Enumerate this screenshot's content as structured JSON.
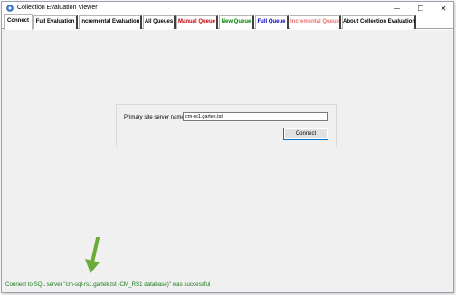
{
  "window": {
    "title": "Collection Evaluation Viewer",
    "controls": {
      "minimize": "─",
      "maximize": "☐",
      "close": "✕"
    }
  },
  "tabs": [
    {
      "label": "Connect",
      "color": "#000000",
      "active": true
    },
    {
      "label": "Full Evaluation",
      "color": "#000000"
    },
    {
      "label": "Incremental Evaluation",
      "color": "#000000"
    },
    {
      "label": "All Queues",
      "color": "#000000"
    },
    {
      "label": "Manual Queue",
      "color": "#c00000"
    },
    {
      "label": "New Queue",
      "color": "#008000"
    },
    {
      "label": "Full Queue",
      "color": "#0000c0"
    },
    {
      "label": "Incremental Queue",
      "color": "#e8706c"
    },
    {
      "label": "About Collection Evaluation",
      "color": "#000000"
    }
  ],
  "connect": {
    "server_label": "Primary site server name",
    "server_value": "cm-rs1.gartek.tst",
    "connect_button": "Connect"
  },
  "status": {
    "message": "Connect to SQL server \"cm-sql-rs1.gartek.tst (CM_RS1 database)\" was successful",
    "color": "#1a7a1a"
  },
  "annotation": {
    "arrow_color": "#6aab3a"
  },
  "icons": {
    "app": "app-icon"
  }
}
